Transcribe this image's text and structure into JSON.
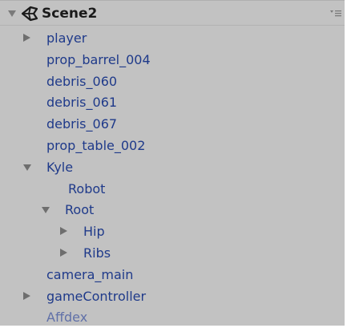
{
  "scene": {
    "title": "Scene2",
    "icon": "unity-scene-icon",
    "menu_icon": "options-menu-icon"
  },
  "hierarchy": [
    {
      "label": "player",
      "indent": 1,
      "foldout": "collapsed",
      "dim": false
    },
    {
      "label": "prop_barrel_004",
      "indent": 1,
      "foldout": "none",
      "dim": false
    },
    {
      "label": "debris_060",
      "indent": 1,
      "foldout": "none",
      "dim": false
    },
    {
      "label": "debris_061",
      "indent": 1,
      "foldout": "none",
      "dim": false
    },
    {
      "label": "debris_067",
      "indent": 1,
      "foldout": "none",
      "dim": false
    },
    {
      "label": "prop_table_002",
      "indent": 1,
      "foldout": "none",
      "dim": false
    },
    {
      "label": "Kyle",
      "indent": 1,
      "foldout": "expanded",
      "dim": false
    },
    {
      "label": "Robot",
      "indent": 2,
      "foldout": "none",
      "dim": false
    },
    {
      "label": "Root",
      "indent": 2,
      "foldout": "expanded",
      "dim": false
    },
    {
      "label": "Hip",
      "indent": 3,
      "foldout": "collapsed",
      "dim": false
    },
    {
      "label": "Ribs",
      "indent": 3,
      "foldout": "collapsed",
      "dim": false
    },
    {
      "label": "camera_main",
      "indent": 1,
      "foldout": "none",
      "dim": false
    },
    {
      "label": "gameController",
      "indent": 1,
      "foldout": "collapsed",
      "dim": false
    },
    {
      "label": "Affdex",
      "indent": 1,
      "foldout": "none",
      "dim": true
    }
  ],
  "colors": {
    "panel_bg": "#c2c2c2",
    "item_text": "#1f3a8a",
    "item_text_dim": "#6070a8",
    "arrow": "#6e6e6e",
    "scene_title": "#1a1a1a"
  }
}
